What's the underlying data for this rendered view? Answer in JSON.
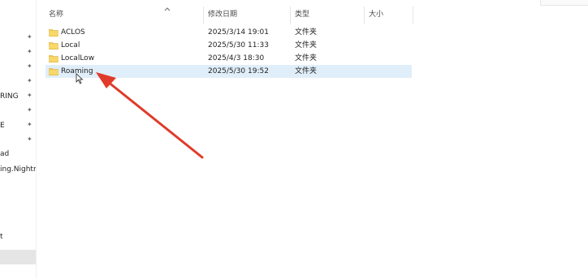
{
  "columns": {
    "name": "名称",
    "modified": "修改日期",
    "type": "类型",
    "size": "大小"
  },
  "files": [
    {
      "name": "ACLOS",
      "modified": "2025/3/14 19:01",
      "type": "文件夹",
      "size": ""
    },
    {
      "name": "Local",
      "modified": "2025/5/30 11:33",
      "type": "文件夹",
      "size": ""
    },
    {
      "name": "LocalLow",
      "modified": "2025/4/3 18:30",
      "type": "文件夹",
      "size": ""
    },
    {
      "name": "Roaming",
      "modified": "2025/5/30 19:52",
      "type": "文件夹",
      "size": "",
      "selected": true
    }
  ],
  "nav": {
    "items": [
      {
        "label": "RING"
      },
      {
        "label": "E"
      },
      {
        "label": "ad"
      },
      {
        "label": "ing.Nightr"
      },
      {
        "label": "t"
      }
    ]
  },
  "colors": {
    "selection": "#e0eef9",
    "folder": "#f2c84b",
    "annotation_arrow": "#e03a2a"
  },
  "icons": {
    "folder": "folder-icon",
    "pin": "pin-icon",
    "sort": "chevron-up-icon",
    "cursor": "mouse-cursor-icon"
  }
}
